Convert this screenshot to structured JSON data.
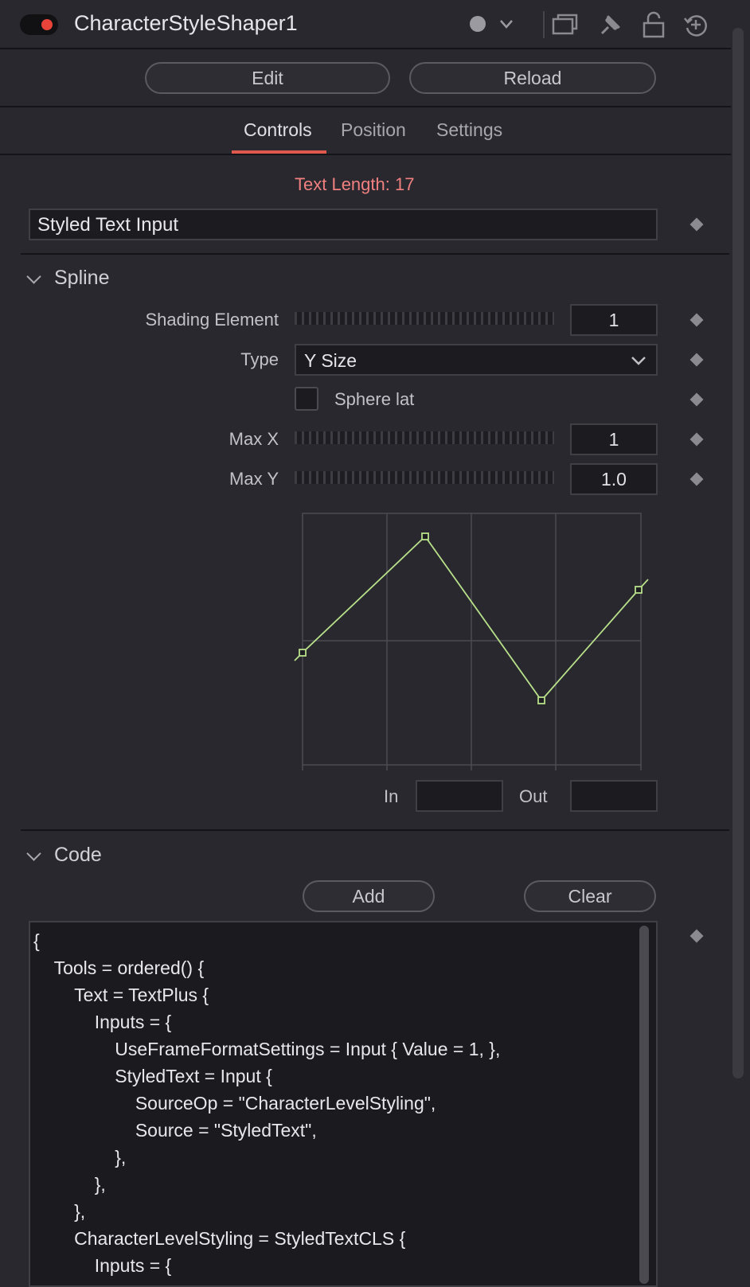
{
  "header": {
    "title": "CharacterStyleShaper1",
    "icons": [
      "power-toggle-icon",
      "color-dot-icon",
      "chevron-down-icon",
      "window-icon",
      "pin-icon",
      "lock-icon",
      "reset-icon"
    ]
  },
  "actions": {
    "edit_label": "Edit",
    "reload_label": "Reload"
  },
  "tabs": [
    {
      "label": "Controls",
      "active": true
    },
    {
      "label": "Position",
      "active": false
    },
    {
      "label": "Settings",
      "active": false
    }
  ],
  "controls": {
    "text_length": "Text Length: 17",
    "styled_text_value": "Styled Text Input"
  },
  "spline": {
    "section_label": "Spline",
    "shading_element": {
      "label": "Shading Element",
      "value": "1"
    },
    "type": {
      "label": "Type",
      "value": "Y Size"
    },
    "sphere": {
      "label": "Sphere lat",
      "checked": false
    },
    "max_x": {
      "label": "Max X",
      "value": "1"
    },
    "max_y": {
      "label": "Max Y",
      "value": "1.0"
    },
    "in_label": "In",
    "out_label": "Out",
    "curve_color": "#b8e08a"
  },
  "code": {
    "section_label": "Code",
    "add_label": "Add",
    "clear_label": "Clear",
    "text": "{\n\tTools = ordered() {\n\t\tText = TextPlus {\n\t\t\tInputs = {\n\t\t\t\tUseFrameFormatSettings = Input { Value = 1, },\n\t\t\t\tStyledText = Input {\n\t\t\t\t\tSourceOp = \"CharacterLevelStyling\",\n\t\t\t\t\tSource = \"StyledText\",\n\t\t\t\t},\n\t\t\t},\n\t\t},\n\t\tCharacterLevelStyling = StyledTextCLS {\n\t\t\tInputs = {"
  },
  "colors": {
    "accent": "#e0594f",
    "text_length": "#f08080",
    "background": "#28282e"
  }
}
